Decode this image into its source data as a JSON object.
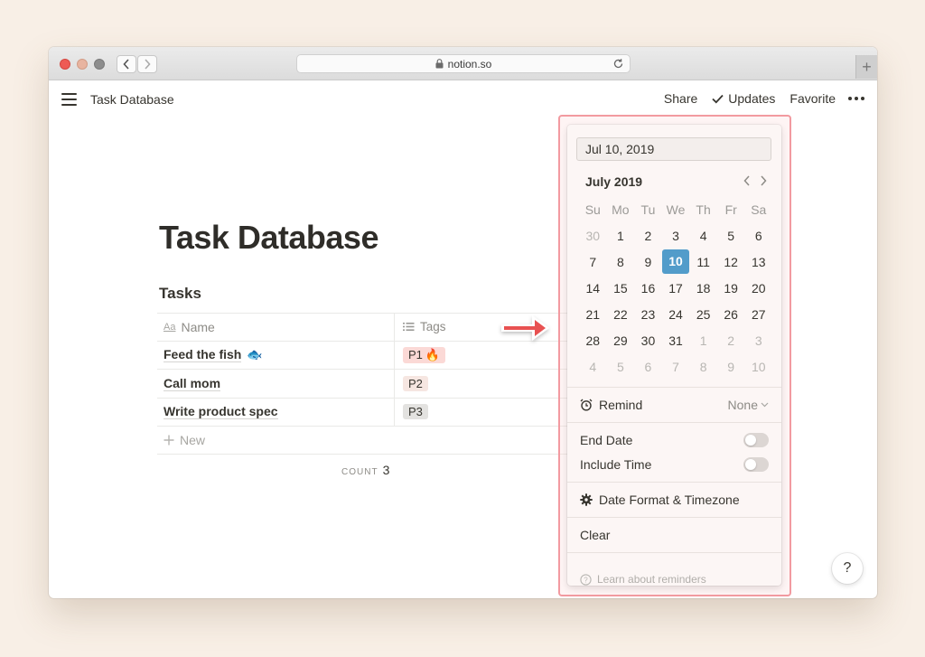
{
  "browser": {
    "url": "notion.so",
    "new_tab_symbol": "+"
  },
  "topbar": {
    "breadcrumb": "Task Database",
    "share": "Share",
    "updates": "Updates",
    "favorite": "Favorite"
  },
  "page": {
    "title": "Task Database",
    "section": "Tasks"
  },
  "table": {
    "headers": {
      "name": "Name",
      "tags": "Tags",
      "name_icon": "Aa"
    },
    "rows": [
      {
        "name": "Feed the fish",
        "emoji": "🐟",
        "tag": "P1",
        "tag_emoji": "🔥",
        "tag_color": "#fbd9d6"
      },
      {
        "name": "Call mom",
        "tag": "P2",
        "tag_color": "#f6e6e1"
      },
      {
        "name": "Write product spec",
        "tag": "P3",
        "tag_color": "#e3e2e0"
      }
    ],
    "new_label": "New",
    "count_label": "COUNT",
    "count_value": "3"
  },
  "datepicker": {
    "value": "Jul 10, 2019",
    "month": "July 2019",
    "weekdays": [
      "Su",
      "Mo",
      "Tu",
      "We",
      "Th",
      "Fr",
      "Sa"
    ],
    "weeks": [
      [
        {
          "d": "30",
          "m": true
        },
        {
          "d": "1"
        },
        {
          "d": "2"
        },
        {
          "d": "3"
        },
        {
          "d": "4"
        },
        {
          "d": "5"
        },
        {
          "d": "6"
        }
      ],
      [
        {
          "d": "7"
        },
        {
          "d": "8"
        },
        {
          "d": "9"
        },
        {
          "d": "10",
          "sel": true
        },
        {
          "d": "11"
        },
        {
          "d": "12"
        },
        {
          "d": "13"
        }
      ],
      [
        {
          "d": "14"
        },
        {
          "d": "15"
        },
        {
          "d": "16"
        },
        {
          "d": "17"
        },
        {
          "d": "18"
        },
        {
          "d": "19"
        },
        {
          "d": "20"
        }
      ],
      [
        {
          "d": "21"
        },
        {
          "d": "22"
        },
        {
          "d": "23"
        },
        {
          "d": "24"
        },
        {
          "d": "25"
        },
        {
          "d": "26"
        },
        {
          "d": "27"
        }
      ],
      [
        {
          "d": "28"
        },
        {
          "d": "29"
        },
        {
          "d": "30"
        },
        {
          "d": "31"
        },
        {
          "d": "1",
          "m": true
        },
        {
          "d": "2",
          "m": true
        },
        {
          "d": "3",
          "m": true
        }
      ],
      [
        {
          "d": "4",
          "m": true
        },
        {
          "d": "5",
          "m": true
        },
        {
          "d": "6",
          "m": true
        },
        {
          "d": "7",
          "m": true
        },
        {
          "d": "8",
          "m": true
        },
        {
          "d": "9",
          "m": true
        },
        {
          "d": "10",
          "m": true
        }
      ]
    ],
    "remind_label": "Remind",
    "remind_value": "None",
    "end_date_label": "End Date",
    "include_time_label": "Include Time",
    "date_format_label": "Date Format & Timezone",
    "clear_label": "Clear",
    "learn_label": "Learn about reminders",
    "selected_color": "#529cca"
  },
  "help_label": "?"
}
